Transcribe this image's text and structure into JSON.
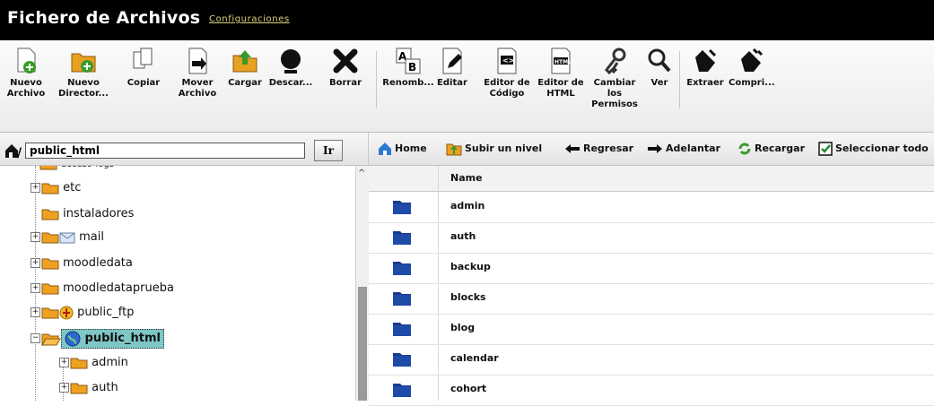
{
  "app": {
    "title": "Fichero de Archivos",
    "config_link": "Configuraciones"
  },
  "toolbar": {
    "buttons": [
      {
        "label": "Nuevo Archivo",
        "icon": "new-file-icon"
      },
      {
        "label": "Nuevo Director...",
        "icon": "new-folder-icon"
      },
      {
        "label": "Copiar",
        "icon": "copy-icon"
      },
      {
        "label": "Mover Archivo",
        "icon": "move-icon"
      },
      {
        "label": "Cargar",
        "icon": "upload-icon"
      },
      {
        "label": "Descar...",
        "icon": "download-icon"
      },
      {
        "label": "Borrar",
        "icon": "delete-icon"
      },
      {
        "label": "Renomb...",
        "icon": "rename-icon"
      },
      {
        "label": "Editar",
        "icon": "edit-icon"
      },
      {
        "label": "Editor de Código",
        "icon": "code-editor-icon"
      },
      {
        "label": "Editor de HTML",
        "icon": "html-editor-icon"
      },
      {
        "label": "Cambiar los Permisos",
        "icon": "permissions-icon"
      },
      {
        "label": "Ver",
        "icon": "view-icon"
      },
      {
        "label": "Extraer",
        "icon": "extract-icon"
      },
      {
        "label": "Compri...",
        "icon": "compress-icon"
      }
    ]
  },
  "path": {
    "value": "public_html",
    "go_label": "Ir"
  },
  "tree": {
    "items": [
      {
        "label": "acceso-logs",
        "expander": true
      },
      {
        "label": "etc",
        "expander": true
      },
      {
        "label": "instaladores",
        "expander": false
      },
      {
        "label": "mail",
        "expander": true
      },
      {
        "label": "moodledata",
        "expander": true
      },
      {
        "label": "moodledataprueba",
        "expander": true
      },
      {
        "label": "public_ftp",
        "expander": true
      },
      {
        "label": "public_html",
        "expander": true,
        "selected": true
      },
      {
        "label": "admin",
        "expander": true
      },
      {
        "label": "auth",
        "expander": true
      }
    ]
  },
  "nav": {
    "home": "Home",
    "up": "Subir un nivel",
    "back": "Regresar",
    "forward": "Adelantar",
    "reload": "Recargar",
    "select_all": "Seleccionar todo"
  },
  "files": {
    "column_name": "Name",
    "rows": [
      "admin",
      "auth",
      "backup",
      "blocks",
      "blog",
      "calendar",
      "cohort"
    ]
  },
  "colors": {
    "titlebar": "#000000",
    "folder_dark": "#1a3a8a",
    "folder_yellow": "#f0a020",
    "selection": "#7fc6c6"
  }
}
